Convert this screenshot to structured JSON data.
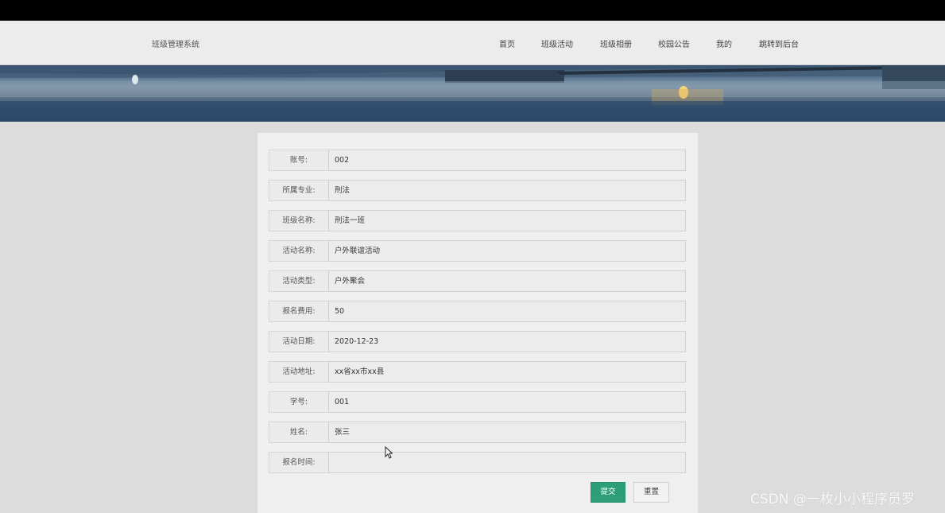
{
  "header": {
    "brand": "班级管理系统",
    "nav": [
      {
        "label": "首页"
      },
      {
        "label": "班级活动"
      },
      {
        "label": "班级相册"
      },
      {
        "label": "校园公告"
      },
      {
        "label": "我的"
      },
      {
        "label": "跳转到后台"
      }
    ]
  },
  "form": {
    "fields": [
      {
        "label": "账号:",
        "value": "002"
      },
      {
        "label": "所属专业:",
        "value": "刑法"
      },
      {
        "label": "班级名称:",
        "value": "刑法一班"
      },
      {
        "label": "活动名称:",
        "value": "户外联谊活动"
      },
      {
        "label": "活动类型:",
        "value": "户外聚会"
      },
      {
        "label": "报名费用:",
        "value": "50"
      },
      {
        "label": "活动日期:",
        "value": "2020-12-23"
      },
      {
        "label": "活动地址:",
        "value": "xx省xx市xx县"
      },
      {
        "label": "学号:",
        "value": "001"
      },
      {
        "label": "姓名:",
        "value": "张三"
      },
      {
        "label": "报名时间:",
        "value": ""
      }
    ],
    "submit_label": "提交",
    "reset_label": "重置"
  },
  "watermark": "CSDN @一枚小小程序员罗",
  "colors": {
    "submit_bg": "#2e9e78",
    "page_bg": "#dcdcdc",
    "topbar": "#000000"
  },
  "icons": [
    "mouse-cursor-icon"
  ]
}
